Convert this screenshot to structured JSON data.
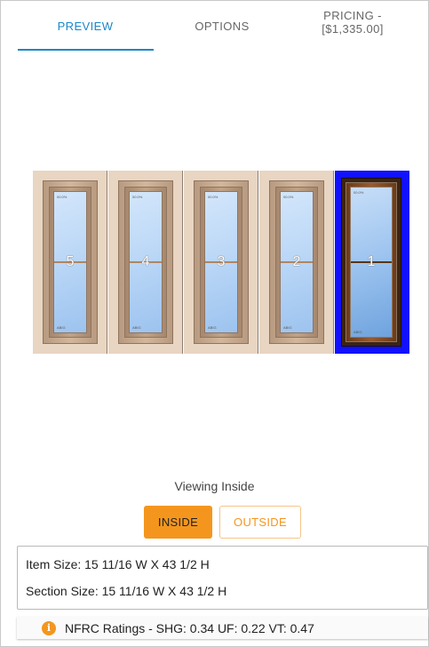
{
  "tabs": {
    "preview": "PREVIEW",
    "options": "OPTIONS",
    "pricing_line1": "PRICING -",
    "pricing_line2": "[$1,335.00]"
  },
  "preview": {
    "units": [
      {
        "number": "5",
        "top_label": "00.0%",
        "bottom_label": "ABIG",
        "selected": false
      },
      {
        "number": "4",
        "top_label": "00.0%",
        "bottom_label": "ABIG",
        "selected": false
      },
      {
        "number": "3",
        "top_label": "00.0%",
        "bottom_label": "ABIG",
        "selected": false
      },
      {
        "number": "2",
        "top_label": "00.0%",
        "bottom_label": "ABIG",
        "selected": false
      },
      {
        "number": "1",
        "top_label": "00.0%",
        "bottom_label": "ABIG",
        "selected": true
      }
    ]
  },
  "view": {
    "status": "Viewing Inside",
    "inside_label": "INSIDE",
    "outside_label": "OUTSIDE"
  },
  "size": {
    "item_size": "Item Size:  15 11/16 W X 43 1/2 H",
    "section_size": "Section Size:  15 11/16 W X 43 1/2 H"
  },
  "nfrc": {
    "icon": "info-icon",
    "text": "NFRC Ratings - SHG: 0.34 UF: 0.22 VT: 0.47"
  },
  "colors": {
    "accent_blue": "#1a87c9",
    "accent_orange": "#f4961e",
    "selection_blue": "#1111ff"
  }
}
